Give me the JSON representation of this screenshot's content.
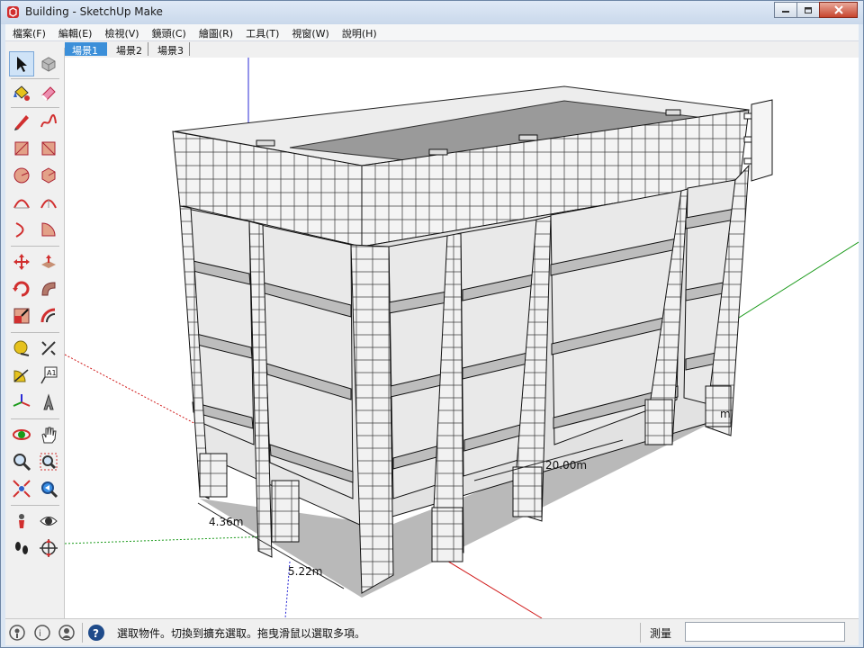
{
  "window": {
    "title": "Building - SketchUp Make"
  },
  "menu": [
    {
      "label": "檔案(F)"
    },
    {
      "label": "編輯(E)"
    },
    {
      "label": "檢視(V)"
    },
    {
      "label": "鏡頭(C)"
    },
    {
      "label": "繪圖(R)"
    },
    {
      "label": "工具(T)"
    },
    {
      "label": "視窗(W)"
    },
    {
      "label": "說明(H)"
    }
  ],
  "scenes": [
    {
      "label": "場景1",
      "active": true
    },
    {
      "label": "場景2",
      "active": false
    },
    {
      "label": "場景3",
      "active": false
    }
  ],
  "tools": [
    {
      "name": "select-tool",
      "icon": "arrow-icon"
    },
    {
      "name": "make-component-tool",
      "icon": "component-icon"
    },
    {
      "name": "paint-bucket-tool",
      "icon": "paint-bucket-icon"
    },
    {
      "name": "eraser-tool",
      "icon": "eraser-icon"
    },
    {
      "name": "line-tool",
      "icon": "pencil-icon"
    },
    {
      "name": "freehand-tool",
      "icon": "freehand-icon"
    },
    {
      "name": "rectangle-tool",
      "icon": "rectangle-icon"
    },
    {
      "name": "rotated-rectangle-tool",
      "icon": "rotated-rectangle-icon"
    },
    {
      "name": "circle-tool",
      "icon": "circle-icon"
    },
    {
      "name": "polygon-tool",
      "icon": "polygon-icon"
    },
    {
      "name": "arc-tool",
      "icon": "arc-icon"
    },
    {
      "name": "two-point-arc-tool",
      "icon": "two-point-arc-icon"
    },
    {
      "name": "three-point-arc-tool",
      "icon": "three-point-arc-icon"
    },
    {
      "name": "pie-tool",
      "icon": "pie-icon"
    },
    {
      "name": "move-tool",
      "icon": "move-icon"
    },
    {
      "name": "push-pull-tool",
      "icon": "push-pull-icon"
    },
    {
      "name": "rotate-tool",
      "icon": "rotate-icon"
    },
    {
      "name": "follow-me-tool",
      "icon": "follow-me-icon"
    },
    {
      "name": "scale-tool",
      "icon": "scale-icon"
    },
    {
      "name": "offset-tool",
      "icon": "offset-icon"
    },
    {
      "name": "tape-measure-tool",
      "icon": "tape-measure-icon"
    },
    {
      "name": "dimension-tool",
      "icon": "dimension-icon"
    },
    {
      "name": "protractor-tool",
      "icon": "protractor-icon"
    },
    {
      "name": "text-tool",
      "icon": "text-icon"
    },
    {
      "name": "axes-tool",
      "icon": "axes-icon"
    },
    {
      "name": "3d-text-tool",
      "icon": "3d-text-icon"
    },
    {
      "name": "orbit-tool",
      "icon": "orbit-icon"
    },
    {
      "name": "pan-tool",
      "icon": "hand-icon"
    },
    {
      "name": "zoom-tool",
      "icon": "magnifier-icon"
    },
    {
      "name": "zoom-window-tool",
      "icon": "zoom-window-icon"
    },
    {
      "name": "zoom-extents-tool",
      "icon": "zoom-extents-icon"
    },
    {
      "name": "previous-view-tool",
      "icon": "previous-view-icon"
    },
    {
      "name": "position-camera-tool",
      "icon": "position-camera-icon"
    },
    {
      "name": "look-around-tool",
      "icon": "eye-icon"
    },
    {
      "name": "walk-tool",
      "icon": "footprints-icon"
    },
    {
      "name": "section-plane-tool",
      "icon": "section-plane-icon"
    }
  ],
  "dimensions": {
    "length": "20.00m",
    "bay_width": "4.36m",
    "bay_depth": "5.22m",
    "side_partial": "m"
  },
  "colors": {
    "axis_red": "#d01818",
    "axis_green": "#1a9a1a",
    "axis_blue": "#2a2ad6",
    "accent_tab": "#3b8fd9"
  },
  "status": {
    "hint": "選取物件。切換到擴充選取。拖曳滑鼠以選取多項。",
    "measure_label": "測量",
    "measure_value": ""
  }
}
